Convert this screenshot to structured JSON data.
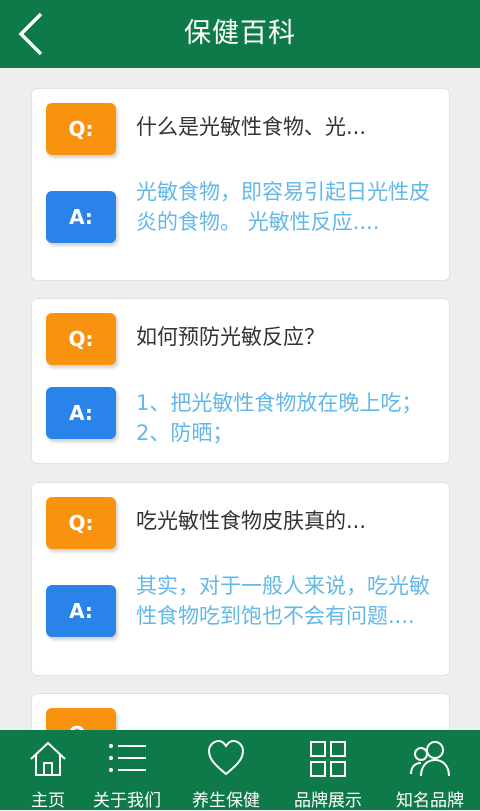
{
  "header": {
    "title": "保健百科",
    "back_icon": "chevron-left-icon"
  },
  "colors": {
    "brand": "#0f7a49",
    "question_badge": "#f9920e",
    "answer_badge": "#2a83e8",
    "answer_text": "#62b8e8"
  },
  "items": [
    {
      "q_badge": "Q:",
      "question": "什么是光敏性食物、光...",
      "a_badge": "A:",
      "answer": "光敏食物，即容易引起日光性皮炎的食物。 光敏性反应...."
    },
    {
      "q_badge": "Q:",
      "question": "如何预防光敏反应？",
      "a_badge": "A:",
      "answer": "1、把光敏性食物放在晚上吃；2、防晒；"
    },
    {
      "q_badge": "Q:",
      "question": "吃光敏性食物皮肤真的...",
      "a_badge": "A:",
      "answer": "其实，对于一般人来说，吃光敏性食物吃到饱也不会有问题...."
    },
    {
      "q_badge": "Q:"
    }
  ],
  "tabs": [
    {
      "label": "主页",
      "icon": "home-icon"
    },
    {
      "label": "关于我们",
      "icon": "list-icon"
    },
    {
      "label": "养生保健",
      "icon": "heart-icon"
    },
    {
      "label": "品牌展示",
      "icon": "grid-icon"
    },
    {
      "label": "知名品牌",
      "icon": "users-icon"
    }
  ]
}
